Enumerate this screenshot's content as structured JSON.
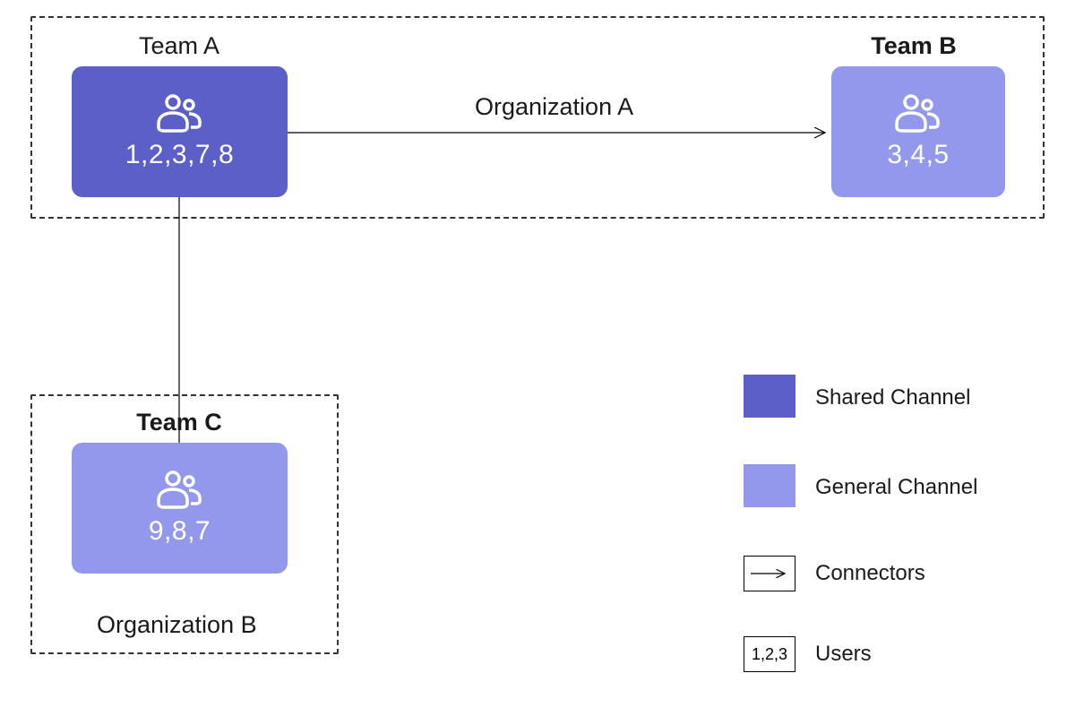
{
  "orgA": {
    "label": "Organization A",
    "teamA": {
      "label": "Team A",
      "members": "1,2,3,7,8"
    },
    "teamB": {
      "label": "Team B",
      "members": "3,4,5"
    }
  },
  "orgB": {
    "label": "Organization B",
    "teamC": {
      "label": "Team C",
      "members": "9,8,7"
    }
  },
  "legend": {
    "shared": "Shared Channel",
    "general": "General Channel",
    "connectors": "Connectors",
    "users": "Users",
    "users_sample": "1,2,3"
  },
  "colors": {
    "shared": "#5B5FC7",
    "general": "#9498ED"
  }
}
